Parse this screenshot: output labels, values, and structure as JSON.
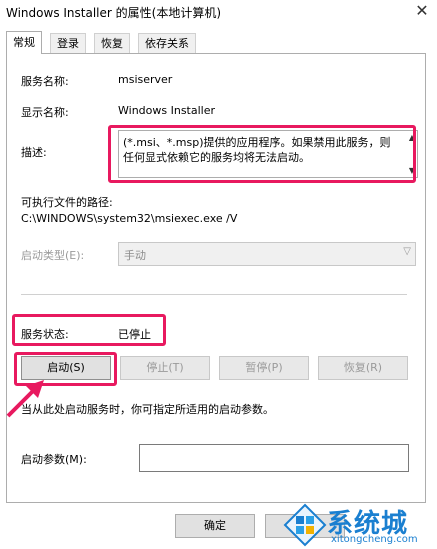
{
  "window": {
    "title": "Windows Installer 的属性(本地计算机)",
    "close_symbol": "✕"
  },
  "tabs": [
    {
      "label": "常规",
      "active": true
    },
    {
      "label": "登录",
      "active": false
    },
    {
      "label": "恢复",
      "active": false
    },
    {
      "label": "依存关系",
      "active": false
    }
  ],
  "general": {
    "service_name_label": "服务名称:",
    "service_name_value": "msiserver",
    "display_name_label": "显示名称:",
    "display_name_value": "Windows Installer",
    "description_label": "描述:",
    "description_value": "(*.msi、*.msp)提供的应用程序。如果禁用此服务，则任何显式依赖它的服务均将无法启动。",
    "exe_path_label": "可执行文件的路径:",
    "exe_path_value": "C:\\WINDOWS\\system32\\msiexec.exe /V",
    "startup_type_label": "启动类型(E):",
    "startup_type_value": "手动",
    "status_label": "服务状态:",
    "status_value": "已停止",
    "buttons": {
      "start": "启动(S)",
      "stop": "停止(T)",
      "pause": "暂停(P)",
      "resume": "恢复(R)"
    },
    "hint_text": "当从此处启动服务时，你可指定所适用的启动参数。",
    "start_params_label": "启动参数(M):",
    "start_params_value": ""
  },
  "footer": {
    "ok_label": "确定"
  },
  "watermark": {
    "name": "系统城",
    "url": "xitongcheng.com"
  },
  "colors": {
    "highlight": "#e8195f",
    "watermark": "#1a7fd0"
  }
}
